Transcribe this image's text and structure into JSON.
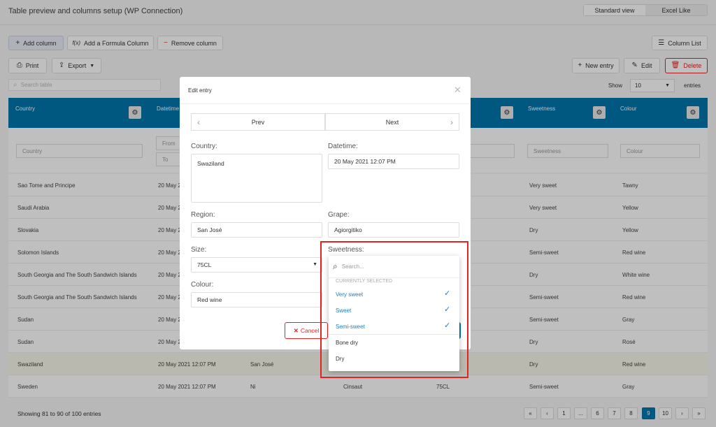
{
  "title": "Table preview and columns setup (WP Connection)",
  "view_toggle": [
    "Standard view",
    "Excel Like"
  ],
  "toolbar": {
    "add_column": "Add column",
    "add_formula": "Add a Formula Column",
    "remove_column": "Remove column",
    "column_list": "Column List",
    "print": "Print",
    "export": "Export",
    "new_entry": "New entry",
    "edit": "Edit",
    "delete": "Delete"
  },
  "search_placeholder": "Search table",
  "show_label": "Show",
  "show_value": "10",
  "entries_label": "entries",
  "columns": [
    "Country",
    "Datetime",
    "Sweetness",
    "Colour"
  ],
  "filters": {
    "country": "Country",
    "from": "From",
    "to": "To",
    "sweetness": "Sweetness",
    "colour": "Colour"
  },
  "rows": [
    {
      "country": "Sao Tome and Principe",
      "datetime": "20 May 2",
      "region": "",
      "grape": "",
      "size": "",
      "sweetness": "Very sweet",
      "colour": "Tawny"
    },
    {
      "country": "Saudi Arabia",
      "datetime": "20 May 2",
      "region": "",
      "grape": "",
      "size": "",
      "sweetness": "Very sweet",
      "colour": "Yellow"
    },
    {
      "country": "Slovakia",
      "datetime": "20 May 2",
      "region": "",
      "grape": "",
      "size": "",
      "sweetness": "Dry",
      "colour": "Yellow"
    },
    {
      "country": "Solomon Islands",
      "datetime": "20 May 2",
      "region": "",
      "grape": "",
      "size": "",
      "sweetness": "Semi-sweet",
      "colour": "Red wine"
    },
    {
      "country": "South Georgia and The South Sandwich Islands",
      "datetime": "20 May 2",
      "region": "",
      "grape": "",
      "size": "",
      "sweetness": "Dry",
      "colour": "White wine"
    },
    {
      "country": "South Georgia and The South Sandwich Islands",
      "datetime": "20 May 2",
      "region": "",
      "grape": "",
      "size": "",
      "sweetness": "Semi-sweet",
      "colour": "Red wine"
    },
    {
      "country": "Sudan",
      "datetime": "20 May 2",
      "region": "",
      "grape": "",
      "size": "",
      "sweetness": "Semi-sweet",
      "colour": "Gray"
    },
    {
      "country": "Sudan",
      "datetime": "20 May 2",
      "region": "",
      "grape": "",
      "size": "",
      "sweetness": "Dry",
      "colour": "Rosé"
    },
    {
      "country": "Swaziland",
      "datetime": "20 May 2021 12:07 PM",
      "region": "San José",
      "grape": "",
      "size": "",
      "sweetness": "Dry",
      "colour": "Red wine"
    },
    {
      "country": "Sweden",
      "datetime": "20 May 2021 12:07 PM",
      "region": "Ni",
      "grape": "Cinsaut",
      "size": "75CL",
      "sweetness": "Semi-sweet",
      "colour": "Gray"
    }
  ],
  "footer": "Showing 81 to 90 of 100 entries",
  "pages": [
    "«",
    "‹",
    "1",
    "...",
    "6",
    "7",
    "8",
    "9",
    "10",
    "›",
    "»"
  ],
  "modal": {
    "title": "Edit entry",
    "prev": "Prev",
    "next": "Next",
    "country_label": "Country:",
    "country_value": "Swaziland",
    "datetime_label": "Datetime:",
    "datetime_value": "20 May 2021 12:07 PM",
    "region_label": "Region:",
    "region_value": "San José",
    "grape_label": "Grape:",
    "grape_value": "Agiorgitiko",
    "size_label": "Size:",
    "size_value": "75CL",
    "sweetness_label": "Sweetness:",
    "colour_label": "Colour:",
    "colour_value": "Red wine",
    "cancel": "Cancel"
  },
  "dropdown": {
    "search_placeholder": "Search...",
    "section": "CURRENTLY SELECTED",
    "selected": [
      "Very sweet",
      "Sweet",
      "Semi-sweet"
    ],
    "other": [
      "Bone dry",
      "Dry"
    ]
  },
  "colors": {
    "header": "#0074ab",
    "highlight": "#e02424",
    "link": "#1a82c4",
    "delete": "#e02424"
  }
}
